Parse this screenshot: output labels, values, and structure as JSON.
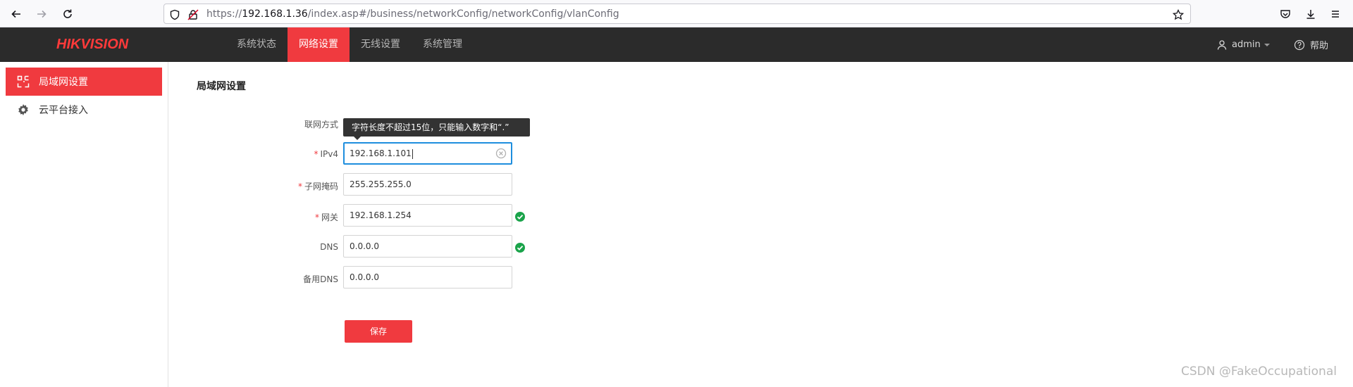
{
  "browser": {
    "url_prefix": "https://",
    "url_host": "192.168.1.36",
    "url_path": "/index.asp#/business/networkConfig/networkConfig/vlanConfig"
  },
  "header": {
    "logo_red": "HIKVISION",
    "nav": [
      {
        "label": "系统状态",
        "active": false
      },
      {
        "label": "网络设置",
        "active": true
      },
      {
        "label": "无线设置",
        "active": false
      },
      {
        "label": "系统管理",
        "active": false
      }
    ],
    "user": "admin",
    "help": "帮助"
  },
  "sidebar": {
    "items": [
      {
        "label": "局域网设置",
        "icon": "lan-icon",
        "active": true
      },
      {
        "label": "云平台接入",
        "icon": "gear-icon",
        "active": false
      }
    ]
  },
  "main": {
    "title": "局域网设置",
    "tooltip": "字符长度不超过15位，只能输入数字和“.”",
    "fields": {
      "mode_label": "联网方式",
      "ipv4_label": "IPv4",
      "ipv4_value": "192.168.1.101",
      "mask_label": "子网掩码",
      "mask_value": "255.255.255.0",
      "gateway_label": "网关",
      "gateway_value": "192.168.1.254",
      "dns_label": "DNS",
      "dns_value": "0.0.0.0",
      "dns2_label": "备用DNS",
      "dns2_value": "0.0.0.0",
      "required_mark": "*"
    },
    "save_label": "保存"
  },
  "watermark": "CSDN @FakeOccupational",
  "colors": {
    "accent": "#f03a3f",
    "header_bg": "#2b2b2b",
    "focus": "#1e8ede",
    "success": "#1aa34a"
  }
}
